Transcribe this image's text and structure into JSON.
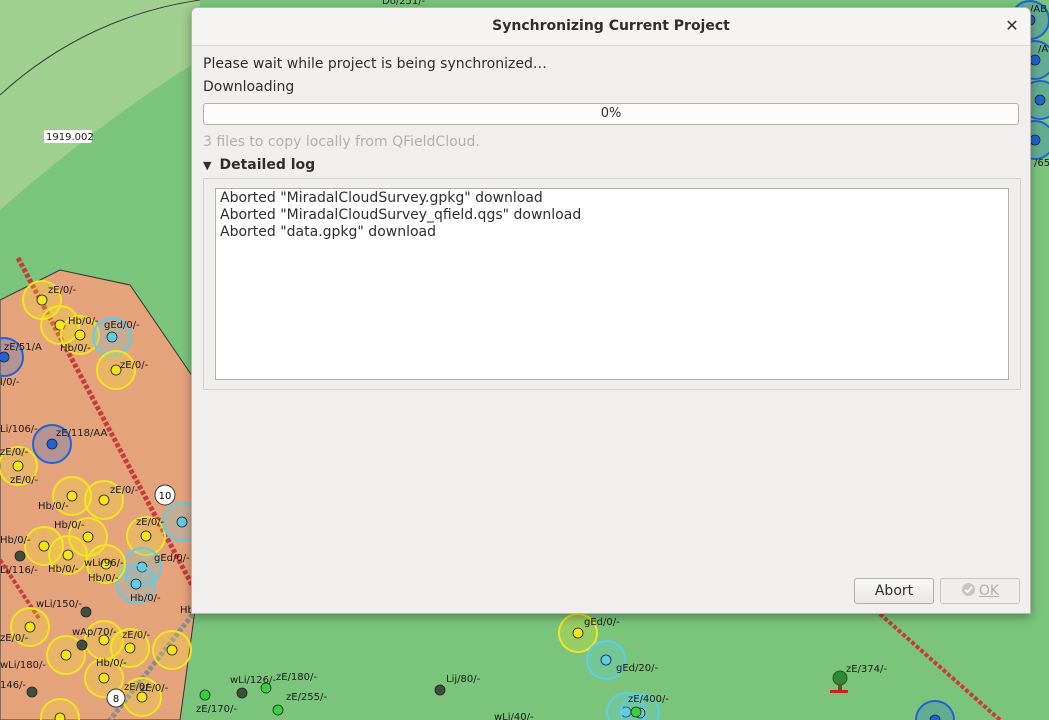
{
  "map": {
    "labels": [
      "1919.002",
      "zE/0/-",
      "Hb/0/-",
      "Hb/0/-",
      "gEd/0/-",
      "zE/0/-",
      "zE/51/A",
      "l/0/-",
      "Li/106/-",
      "zE/118/AA",
      "zE/0/-",
      "zE/0/-",
      "zE/0/-",
      "Hb/0/-",
      "Hb/0/-",
      "zE/0/-",
      "Hb/0/-",
      "gEd/0/-",
      "wLi/96/-",
      "Hb/0/-",
      "Li/116/-",
      "Hb/0/-",
      "Hb/0/-",
      "wLi/150/-",
      "zE/0/-",
      "wAp/70/-",
      "zE/0/-",
      "Hb/0/-",
      "wLi/180/-",
      "zE/0/-",
      "146/-",
      "zE/0/-",
      "wLi/126/-",
      "zE/180/-",
      "zE/255/-",
      "zE/170/-",
      "Lij/80/-",
      "wLi/40/-",
      "gEd/0/-",
      "gEd/20/-",
      "zE/400/-",
      "zE/374/-",
      "Do/251/-",
      "/AB",
      "/A",
      "/65",
      "Hb"
    ],
    "road_numbers": [
      "10",
      "8"
    ],
    "colors": {
      "grass": "#7ac47b",
      "zone": "#e5a37c",
      "yellow": "#f3e61f",
      "blue": "#1f63d6",
      "cyan": "#5ecde8",
      "dark": "#3f4f3a",
      "green": "#39d13b"
    }
  },
  "dialog": {
    "title": "Synchronizing Current Project",
    "close_icon": "close-icon",
    "message": "Please wait while project is being synchronized…",
    "status": "Downloading",
    "progress": {
      "value": 0,
      "label": "0%"
    },
    "hint": "3 files to copy locally from QFieldCloud.",
    "log_toggle_label": "Detailed log",
    "log_lines": [
      "Aborted \"MiradalCloudSurvey.gpkg\" download",
      "Aborted \"MiradalCloudSurvey_qfield.qgs\" download",
      "Aborted \"data.gpkg\" download"
    ],
    "buttons": {
      "abort": "Abort",
      "ok": "OK"
    }
  }
}
